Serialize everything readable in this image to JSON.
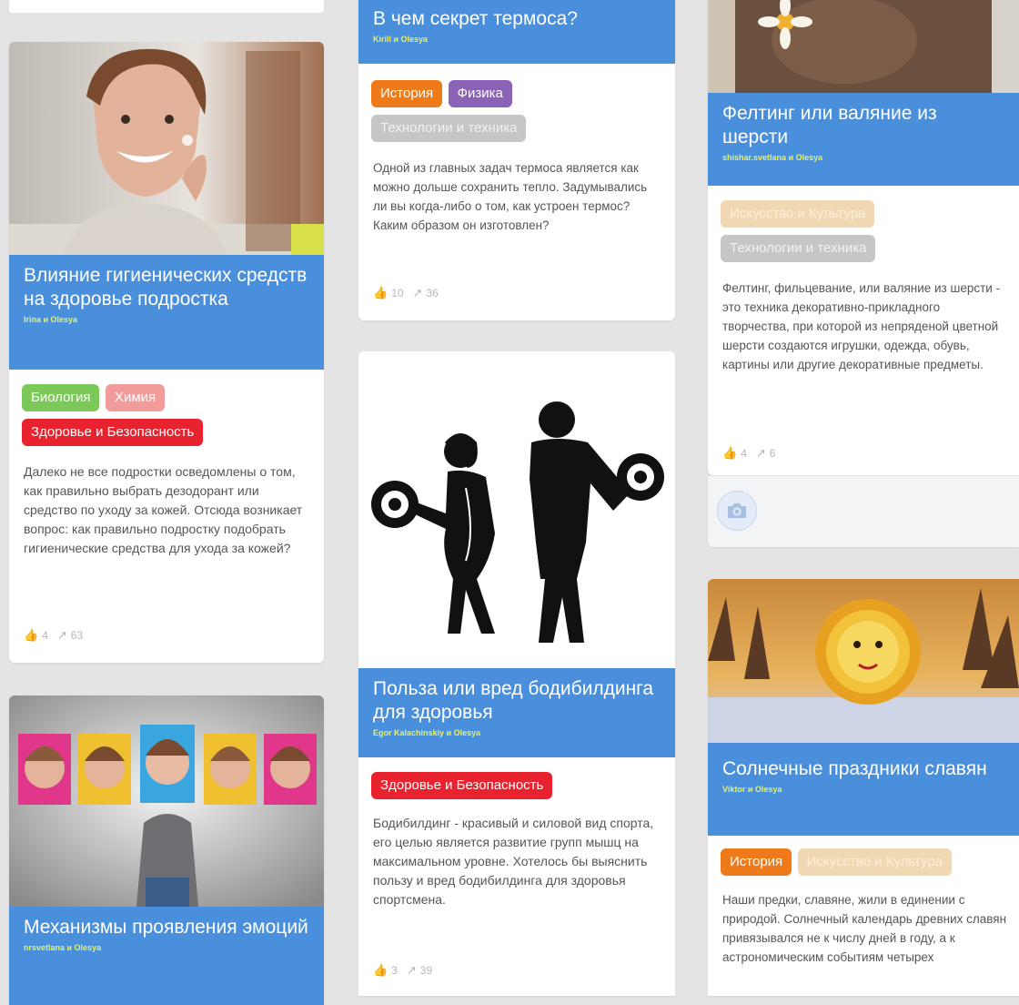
{
  "colors": {
    "header_blue": "#4a8fdb",
    "author_yellow": "#e8f06a",
    "tag_history": "#ef7a1a",
    "tag_physics": "#8a63b6",
    "tag_tech": "#c6c6c6",
    "tag_biology": "#7cc95a",
    "tag_chemistry": "#f29b9b",
    "tag_health": "#e8222e",
    "tag_art": "#f0d9b2"
  },
  "cards": {
    "hygiene": {
      "title": "Влияние гигиенических средств на здоровье подростка",
      "authors": "Irina и Olesya",
      "tags": [
        "Биология",
        "Химия",
        "Здоровье и Безопасность"
      ],
      "description": "Далеко не все подростки осведомлены о том, как правильно выбрать дезодорант или средство по уходу за кожей. Отсюда возникает вопрос: как правильно подростку подобрать гигиенические средства для ухода за кожей?",
      "likes": "4",
      "views": "63"
    },
    "emotions": {
      "title": "Механизмы проявления эмоций",
      "authors": "nrsvetlana и Olesya"
    },
    "thermos": {
      "title": "В чем секрет термоса?",
      "authors": "Kirill и Olesya",
      "tags": [
        "История",
        "Физика",
        "Технологии и техника"
      ],
      "description": "Одной из главных задач термоса является как можно дольше сохранить тепло. Задумывались ли вы когда-либо о том, как устроен термос? Каким образом он изготовлен?",
      "likes": "10",
      "views": "36"
    },
    "bodybuilding": {
      "title": "Польза или вред бодибилдинга для здоровья",
      "authors": "Egor Kalachinskiy и Olesya",
      "tags": [
        "Здоровье и Безопасность"
      ],
      "description": "Бодибилдинг - красивый и силовой вид спорта, его целью является развитие групп мышц на максимальном уровне. Хотелось бы выяснить пользу и вред бодибилдинга для здоровья спортсмена.",
      "likes": "3",
      "views": "39"
    },
    "felting": {
      "title": "Фелтинг или валяние из шерсти",
      "authors": "shishar.svetlana и Olesya",
      "tags": [
        "Искусство и Культура",
        "Технологии и техника"
      ],
      "description": "Фелтинг, фильцевание, или валяние из шерсти - это техника декоративно-прикладного творчества, при которой из непряденой цветной шерсти создаются игрушки, одежда, обувь, картины или другие декоративные предметы.",
      "likes": "4",
      "views": "6"
    },
    "sun": {
      "title": "Солнечные праздники славян",
      "authors": "Viktor и Olesya",
      "tags": [
        "История",
        "Искусство и Культура"
      ],
      "description": "Наши предки, славяне, жили в единении с природой. Солнечный календарь древних славян привязывался не к числу дней в году, а к астрономическим событиям четырех"
    }
  }
}
